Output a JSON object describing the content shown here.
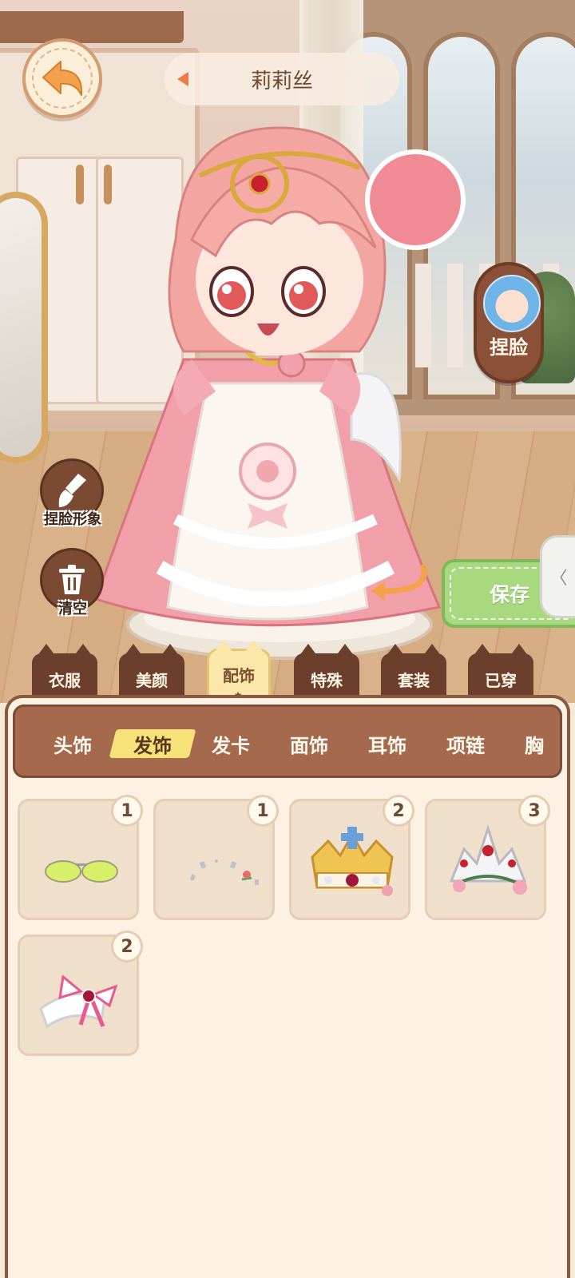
{
  "header": {
    "character_name": "莉莉丝"
  },
  "face_edit": {
    "label": "捏脸"
  },
  "tools": {
    "pinch_image_label": "捏脸形象",
    "clear_label": "清空"
  },
  "save": {
    "label": "保存"
  },
  "category_tabs": {
    "items": [
      {
        "label": "衣服"
      },
      {
        "label": "美颜"
      },
      {
        "label": "配饰"
      },
      {
        "label": "特殊"
      },
      {
        "label": "套装"
      },
      {
        "label": "已穿"
      }
    ],
    "active": "配饰"
  },
  "sub_tabs": {
    "items": [
      {
        "label": "头饰"
      },
      {
        "label": "发饰"
      },
      {
        "label": "发卡"
      },
      {
        "label": "面饰"
      },
      {
        "label": "耳饰"
      },
      {
        "label": "项链"
      },
      {
        "label": "胸"
      }
    ],
    "active": "发饰"
  },
  "items": [
    {
      "icon": "sunglasses-icon",
      "count": "1"
    },
    {
      "icon": "sparkle-hairpins-icon",
      "count": "1"
    },
    {
      "icon": "golden-crown-icon",
      "count": "2"
    },
    {
      "icon": "rose-tiara-icon",
      "count": "3"
    },
    {
      "icon": "ribbon-headband-icon",
      "count": "2"
    }
  ],
  "colors": {
    "accent_brown": "#8a5a3f",
    "save_green": "#a9d97f",
    "active_tab_yellow": "#fbe7a9"
  }
}
